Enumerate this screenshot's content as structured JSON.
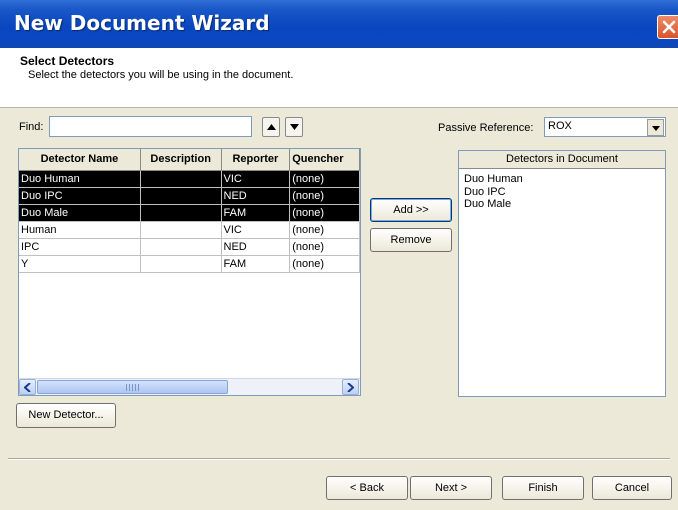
{
  "window": {
    "title": "New Document Wizard"
  },
  "header": {
    "title": "Select Detectors",
    "subtitle": "Select the detectors you will be using in the document."
  },
  "find": {
    "label": "Find:",
    "value": "",
    "placeholder": ""
  },
  "passive_reference": {
    "label": "Passive Reference:",
    "value": "ROX"
  },
  "detector_table": {
    "columns": [
      "Detector Name",
      "Description",
      "Reporter",
      "Quencher"
    ],
    "rows": [
      {
        "name": "Duo Human",
        "description": "",
        "reporter": "VIC",
        "quencher": "(none)",
        "selected": true
      },
      {
        "name": "Duo IPC",
        "description": "",
        "reporter": "NED",
        "quencher": "(none)",
        "selected": true
      },
      {
        "name": "Duo Male",
        "description": "",
        "reporter": "FAM",
        "quencher": "(none)",
        "selected": true
      },
      {
        "name": "Human",
        "description": "",
        "reporter": "VIC",
        "quencher": "(none)",
        "selected": false
      },
      {
        "name": "IPC",
        "description": "",
        "reporter": "NED",
        "quencher": "(none)",
        "selected": false
      },
      {
        "name": "Y",
        "description": "",
        "reporter": "FAM",
        "quencher": "(none)",
        "selected": false
      }
    ]
  },
  "buttons": {
    "add": "Add >>",
    "remove": "Remove",
    "new_detector": "New Detector...",
    "back": "< Back",
    "next": "Next >",
    "finish": "Finish",
    "cancel": "Cancel"
  },
  "document_detectors": {
    "header": "Detectors in Document",
    "items": [
      "Duo Human",
      "Duo IPC",
      "Duo Male"
    ]
  },
  "icons": {
    "close": "close-icon",
    "move_up": "arrow-up-icon",
    "move_down": "arrow-down-icon",
    "dropdown": "chevron-down-icon",
    "scroll_left": "arrow-left-icon",
    "scroll_right": "arrow-right-icon"
  },
  "colors": {
    "title_bar": "#0a46be",
    "selection": "#000000",
    "close_button": "#d8542c",
    "dialog_background": "#ece9d8"
  }
}
